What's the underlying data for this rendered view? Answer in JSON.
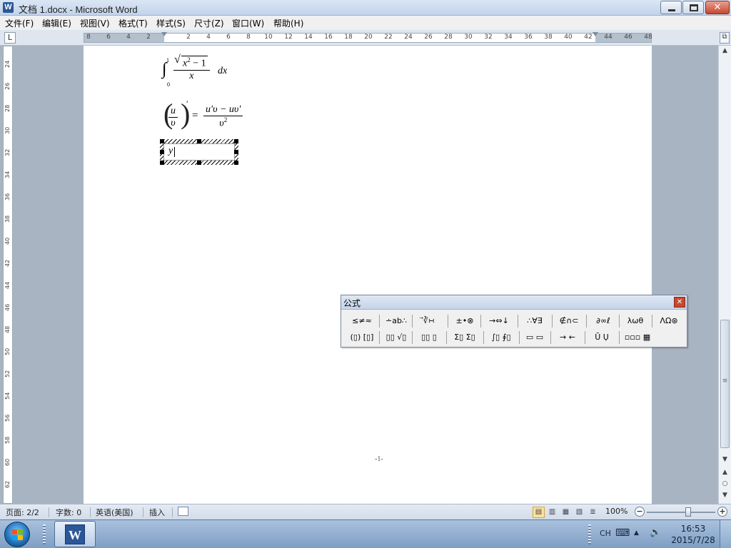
{
  "window": {
    "title": "文档 1.docx - Microsoft Word",
    "app_icon": "W",
    "close_glyph": "✕"
  },
  "menu": {
    "items": [
      "文件(F)",
      "编辑(E)",
      "视图(V)",
      "格式(T)",
      "样式(S)",
      "尺寸(Z)",
      "窗口(W)",
      "帮助(H)"
    ]
  },
  "ruler": {
    "tab_selector": "L",
    "labels": [
      "8",
      "6",
      "4",
      "2",
      "2",
      "4",
      "6",
      "8",
      "10",
      "12",
      "14",
      "16",
      "18",
      "20",
      "22",
      "24",
      "26",
      "28",
      "30",
      "32",
      "34",
      "36",
      "38",
      "40",
      "42",
      "44",
      "46",
      "48"
    ],
    "vertical_labels": [
      "24",
      "26",
      "28",
      "30",
      "32",
      "34",
      "36",
      "38",
      "40",
      "42",
      "44",
      "46",
      "48",
      "50",
      "52",
      "54",
      "56",
      "58",
      "60",
      "62"
    ],
    "right_icon": "⧉"
  },
  "equations": {
    "eq1": {
      "upper": "1",
      "lower": "0",
      "integral": "∫",
      "numerator_var": "x",
      "numerator_exp": "2",
      "numerator_rest": " − 1",
      "denominator": "x",
      "dx": "dx"
    },
    "eq2": {
      "inner_num": "u",
      "inner_den": "υ",
      "prime": "′",
      "equals": "=",
      "rhs_num": "u′υ − uυ′",
      "rhs_den_var": "υ",
      "rhs_den_exp": "2",
      "left_paren": "(",
      "right_paren": ")"
    },
    "edit_box_text": "y"
  },
  "page": {
    "page_number": "-1-"
  },
  "scrollbar": {
    "up": "▲",
    "down": "▼",
    "prev": "▲",
    "browse": "○",
    "next": "▼",
    "grip": "≡"
  },
  "formula_toolbar": {
    "title": "公式",
    "close": "✕",
    "row1": [
      "≤≠≈",
      "∸ab∴",
      "⃗∛∺",
      "±•⊗",
      "→⇔↓",
      "∴∀∃",
      "∉∩⊂",
      "∂∞ℓ",
      "λωθ",
      "ΛΩ⊛"
    ],
    "row2": [
      "(▯) [▯]",
      "▯▯ √▯",
      "▯▯ ▯",
      "Σ▯ Σ▯",
      "∫▯ ∮▯",
      "▭ ▭",
      "→ ←",
      "Ū Ụ",
      "▫▫▫ ▦"
    ]
  },
  "status": {
    "page": "页面: 2/2",
    "words": "字数: 0",
    "language": "英语(美国)",
    "mode": "插入",
    "zoom": "100%",
    "zoom_minus": "−",
    "zoom_plus": "+",
    "zoom_level_pct": 60,
    "views": [
      "▤",
      "▥",
      "▦",
      "▧",
      "≣"
    ]
  },
  "taskbar": {
    "word_glyph": "W",
    "ime": "CH",
    "time": "16:53",
    "date": "2015/7/28",
    "tray_keyboard": "⌨",
    "tray_up": "▲",
    "tray_volume": "🔈"
  },
  "colors": {
    "accent": "#2b5797",
    "close_red": "#c7472f",
    "page_bg": "#ffffff",
    "workspace": "#a9b4c2"
  }
}
